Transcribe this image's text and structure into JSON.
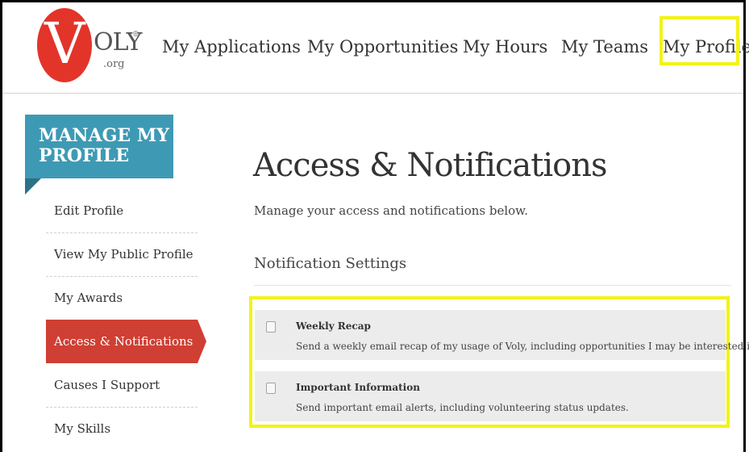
{
  "logo": {
    "letter": "V",
    "name": "OLY",
    "tm": "®",
    "tld": ".org"
  },
  "nav": {
    "items": [
      "My Applications",
      "My Opportunities",
      "My Hours",
      "My Teams",
      "My Profile"
    ]
  },
  "sidebar": {
    "heading": "MANAGE MY PROFILE",
    "items": [
      "Edit Profile",
      "View My Public Profile",
      "My Awards",
      "Access & Notifications",
      "Causes I Support",
      "My Skills"
    ],
    "active_index": 3
  },
  "main": {
    "title": "Access & Notifications",
    "subtitle": "Manage your access and notifications below.",
    "section_title": "Notification Settings",
    "notifications": [
      {
        "title": "Weekly Recap",
        "description": "Send a weekly email recap of my usage of Voly, including opportunities I may be interested in.",
        "checked": false
      },
      {
        "title": "Important Information",
        "description": "Send important email alerts, including volunteering status updates.",
        "checked": false
      }
    ]
  },
  "colors": {
    "brand_red": "#e3342a",
    "heading_teal": "#3e9ab4",
    "active_red": "#cf3f33",
    "highlight_yellow": "#f2f21a"
  }
}
